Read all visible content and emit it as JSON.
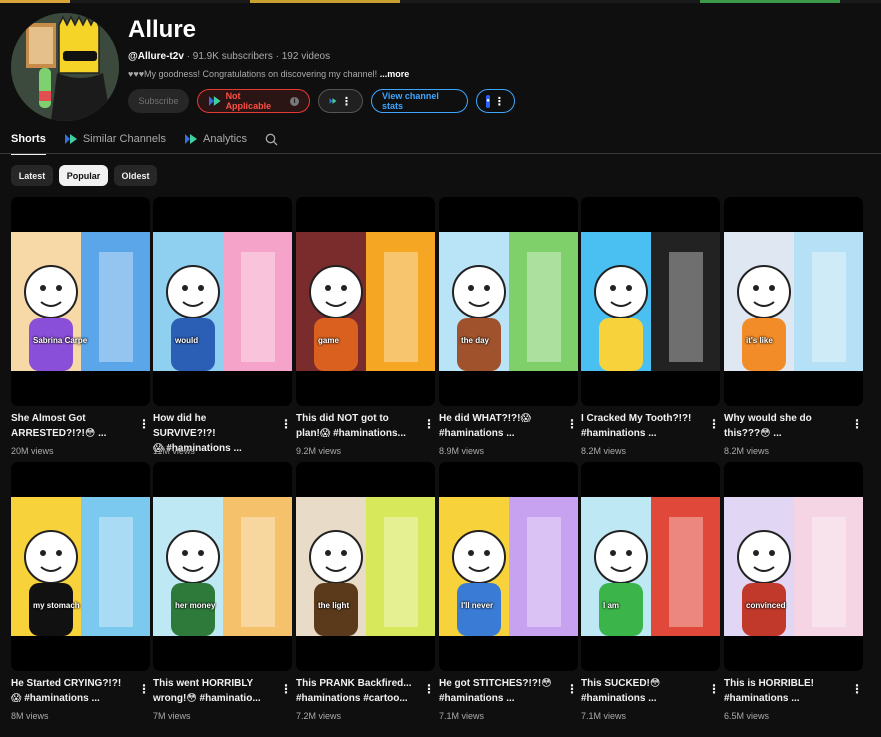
{
  "channel": {
    "name": "Allure",
    "handle": "@Allure-t2v",
    "subscribers": "91.9K subscribers",
    "videos": "192 videos",
    "separator": "·",
    "description": "♥♥♥My goodness! Congratulations on discovering my channel!",
    "more": "...more"
  },
  "buttons": {
    "subscribe": "Subscribe",
    "not_applicable": "Not Applicable",
    "view_stats": "View channel stats",
    "ext_badge": "●"
  },
  "tabs": [
    {
      "label": "Shorts"
    },
    {
      "label": "Similar Channels"
    },
    {
      "label": "Analytics"
    }
  ],
  "chips": [
    "Latest",
    "Popular",
    "Oldest"
  ],
  "videos": [
    {
      "title_1": "She Almost Got",
      "title_2": "ARRESTED?!?!😳 ...",
      "views": "20M views",
      "caption": "Sabrina Carpe",
      "bg1": "#f7d9a8",
      "bg2": "#5aa6e8",
      "accent": "#8a4fd8"
    },
    {
      "title_1": "How did he SURVIVE?!?!",
      "title_2": "😱 #haminations ...",
      "views": "11M views",
      "caption": "would",
      "bg1": "#8fd0f0",
      "bg2": "#f5a3c8",
      "accent": "#2b5fb5"
    },
    {
      "title_1": "This did NOT got to",
      "title_2": "plan!😱 #haminations...",
      "views": "9.2M views",
      "caption": "game",
      "bg1": "#7a2b2b",
      "bg2": "#f5a623",
      "accent": "#d9601e"
    },
    {
      "title_1": "He did WHAT?!?!😱",
      "title_2": "#haminations ...",
      "views": "8.9M views",
      "caption": "the day",
      "bg1": "#b9e4f7",
      "bg2": "#7fcf6a",
      "accent": "#a0522d"
    },
    {
      "title_1": "I Cracked My Tooth?!?!",
      "title_2": "#haminations ...",
      "views": "8.2M views",
      "caption": "",
      "bg1": "#4ac0f2",
      "bg2": "#222",
      "accent": "#f7d23b"
    },
    {
      "title_1": "Why would she do",
      "title_2": "this???😳 ...",
      "views": "8.2M views",
      "caption": "it's like",
      "bg1": "#dfe8f2",
      "bg2": "#b6e0f5",
      "accent": "#f28c28"
    },
    {
      "title_1": "He Started CRYING?!?!",
      "title_2": "😱 #haminations ...",
      "views": "8M views",
      "caption": "my stomach",
      "bg1": "#f7d23b",
      "bg2": "#7bc9ef",
      "accent": "#111"
    },
    {
      "title_1": "This went HORRIBLY",
      "title_2": "wrong!😳 #haminatio...",
      "views": "7M views",
      "caption": "her money",
      "bg1": "#bfe8f5",
      "bg2": "#f5c26b",
      "accent": "#2d7a3a"
    },
    {
      "title_1": "This PRANK Backfired...",
      "title_2": "#haminations #cartoo...",
      "views": "7.2M views",
      "caption": "the light",
      "bg1": "#e8dcc8",
      "bg2": "#d7e85a",
      "accent": "#5a3a1a"
    },
    {
      "title_1": "He got STITCHES?!?!😳",
      "title_2": "#haminations ...",
      "views": "7.1M views",
      "caption": "I'll never",
      "bg1": "#f7d23b",
      "bg2": "#c7a2f0",
      "accent": "#3a7bd5"
    },
    {
      "title_1": "This SUCKED!😳",
      "title_2": "#haminations ...",
      "views": "7.1M views",
      "caption": "I am",
      "bg1": "#bfe8f5",
      "bg2": "#e0483a",
      "accent": "#3bb54a"
    },
    {
      "title_1": "This is HORRIBLE!",
      "title_2": "#haminations ...",
      "views": "6.5M views",
      "caption": "convinced",
      "bg1": "#e2d6f5",
      "bg2": "#f5d4e3",
      "accent": "#c0392b"
    }
  ],
  "colors": {
    "background": "#0f0f0f",
    "link_blue": "#3ea6ff",
    "not_applicable_red": "#ff4e45"
  }
}
